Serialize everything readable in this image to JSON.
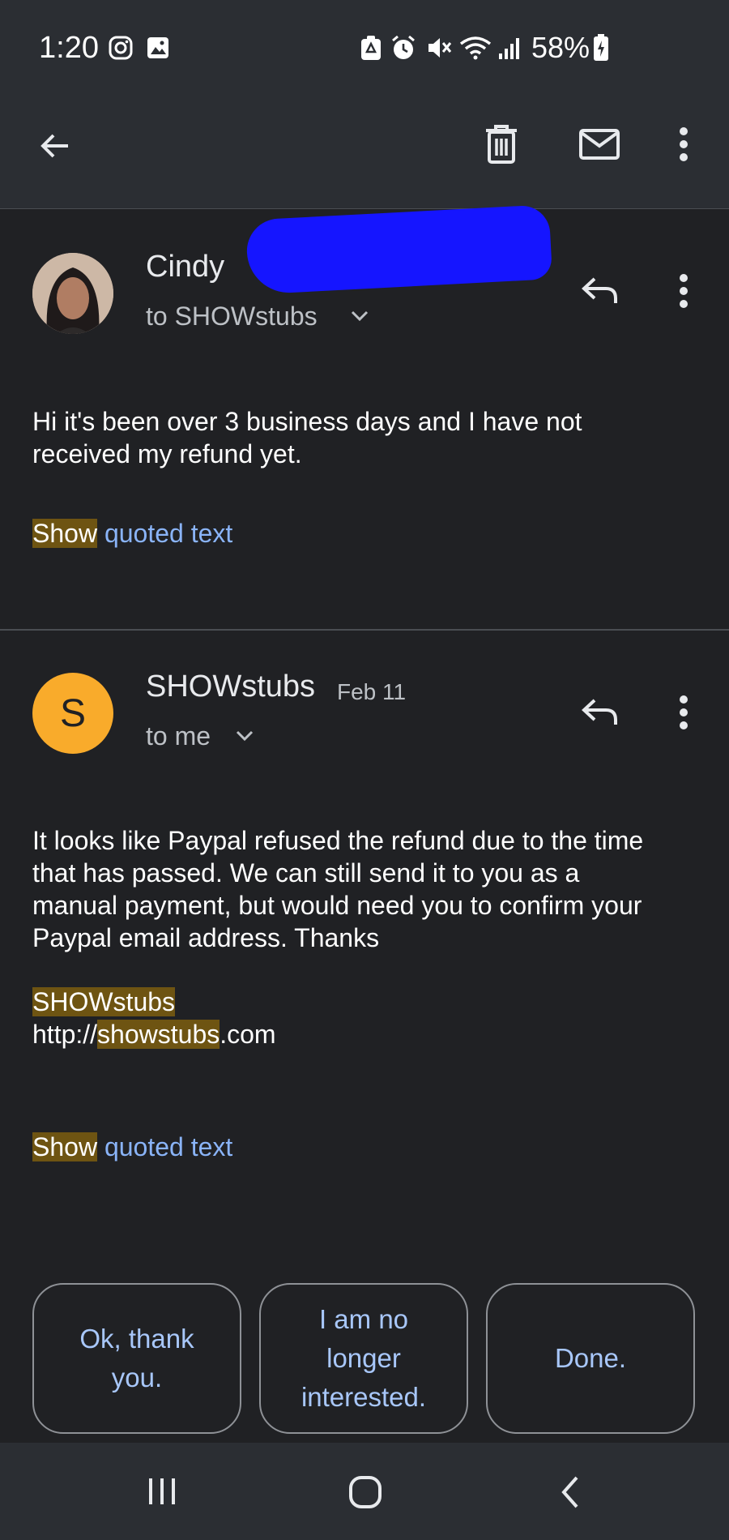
{
  "status_bar": {
    "time": "1:20",
    "battery": "58%",
    "icons": [
      "instagram-icon",
      "gallery-icon",
      "recycle-icon",
      "alarm-icon",
      "mute-icon",
      "wifi-icon",
      "signal-icon",
      "battery-charging-icon"
    ]
  },
  "app_bar": {
    "icons": [
      "back-arrow-icon",
      "delete-icon",
      "mark-unread-icon",
      "more-vert-icon"
    ]
  },
  "messages": [
    {
      "sender": "Cindy",
      "recipient": "to SHOWstubs",
      "body_lines": [
        "Hi it's been over 3 business days and I have not",
        "received my refund yet."
      ],
      "show_label": "Show",
      "quoted_label": "quoted text"
    },
    {
      "avatar_letter": "S",
      "sender": "SHOWstubs",
      "date": "Feb 11",
      "recipient": "to me",
      "body_lines": [
        "It looks like Paypal refused the refund due to the time",
        "that has passed. We can still send it to you as a",
        "manual payment, but would need you to confirm your",
        "Paypal email address. Thanks"
      ],
      "signature_name": "SHOWstubs",
      "signature_url_prefix": "http://",
      "signature_url_highlight": "showstubs",
      "signature_url_suffix": ".com",
      "show_label": "Show",
      "quoted_label": "quoted text"
    }
  ],
  "smart_replies": [
    {
      "line1": "Ok, thank",
      "line2": "you."
    },
    {
      "line1": "I am no",
      "line2": "longer",
      "line3": "interested."
    },
    {
      "line1": "Done."
    }
  ],
  "colors": {
    "background": "#202124",
    "highlight": "#6e5412",
    "link": "#8ab4f8",
    "avatar_s": "#f9ab2b",
    "chip_text": "#a8c7fa"
  }
}
